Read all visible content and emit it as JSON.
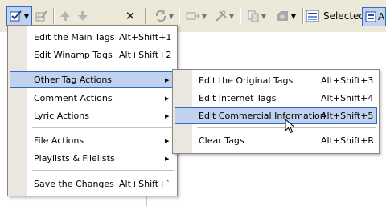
{
  "toolbar": {
    "selected_label": "Selected",
    "right_label_partial": "A"
  },
  "main_menu": {
    "items": [
      {
        "label": "Edit the Main Tags",
        "shortcut": "Alt+Shift+1"
      },
      {
        "label": "Edit Winamp Tags",
        "shortcut": "Alt+Shift+2"
      },
      {
        "label": "Other Tag Actions"
      },
      {
        "label": "Comment Actions"
      },
      {
        "label": "Lyric Actions"
      },
      {
        "label": "File Actions"
      },
      {
        "label": "Playlists & Filelists"
      },
      {
        "label": "Save the Changes",
        "shortcut": "Alt+Shift+`"
      }
    ]
  },
  "submenu": {
    "items": [
      {
        "label": "Edit the Original Tags",
        "shortcut": "Alt+Shift+3"
      },
      {
        "label": "Edit Internet Tags",
        "shortcut": "Alt+Shift+4"
      },
      {
        "label": "Edit Commercial Information",
        "shortcut": "Alt+Shift+5"
      },
      {
        "label": "Clear Tags",
        "shortcut": "Alt+Shift+R"
      }
    ]
  },
  "colors": {
    "toolbar_bg": "#ece9d8",
    "highlight_bg": "#c1d2ee",
    "highlight_border": "#316ac5"
  }
}
